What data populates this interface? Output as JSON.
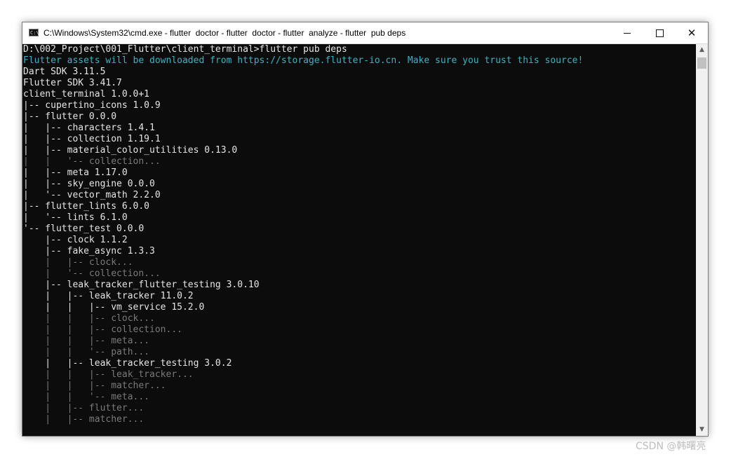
{
  "window": {
    "title": "C:\\Windows\\System32\\cmd.exe - flutter  doctor - flutter  doctor - flutter  analyze - flutter  pub deps",
    "icon_name": "cmd-icon",
    "minimize_label": "",
    "maximize_label": "",
    "close_label": "✕"
  },
  "colors": {
    "terminal_bg": "#0c0c0c",
    "text": "#cccccc",
    "cyan": "#3ab4c2",
    "dim": "#7a7a7a"
  },
  "terminal": {
    "lines": [
      {
        "text": "D:\\002_Project\\001_Flutter\\client_terminal>flutter pub deps",
        "style": "bright"
      },
      {
        "text": "Flutter assets will be downloaded from https://storage.flutter-io.cn. Make sure you trust this source!",
        "style": "cyan"
      },
      {
        "text": "Dart SDK 3.11.5",
        "style": "bright"
      },
      {
        "text": "Flutter SDK 3.41.7",
        "style": "bright"
      },
      {
        "text": "client_terminal 1.0.0+1",
        "style": "bright"
      },
      {
        "text": "|-- cupertino_icons 1.0.9",
        "style": "bright"
      },
      {
        "text": "|-- flutter 0.0.0",
        "style": "bright"
      },
      {
        "text": "|   |-- characters 1.4.1",
        "style": "bright"
      },
      {
        "text": "|   |-- collection 1.19.1",
        "style": "bright"
      },
      {
        "text": "|   |-- material_color_utilities 0.13.0",
        "style": "bright"
      },
      {
        "text": "|   |   '-- collection...",
        "style": "dim"
      },
      {
        "text": "|   |-- meta 1.17.0",
        "style": "bright"
      },
      {
        "text": "|   |-- sky_engine 0.0.0",
        "style": "bright"
      },
      {
        "text": "|   '-- vector_math 2.2.0",
        "style": "bright"
      },
      {
        "text": "|-- flutter_lints 6.0.0",
        "style": "bright"
      },
      {
        "text": "|   '-- lints 6.1.0",
        "style": "bright"
      },
      {
        "text": "'-- flutter_test 0.0.0",
        "style": "bright"
      },
      {
        "text": "    |-- clock 1.1.2",
        "style": "bright"
      },
      {
        "text": "    |-- fake_async 1.3.3",
        "style": "bright"
      },
      {
        "text": "    |   |-- clock...",
        "style": "dim"
      },
      {
        "text": "    |   '-- collection...",
        "style": "dim"
      },
      {
        "text": "    |-- leak_tracker_flutter_testing 3.0.10",
        "style": "bright"
      },
      {
        "text": "    |   |-- leak_tracker 11.0.2",
        "style": "bright"
      },
      {
        "text": "    |   |   |-- vm_service 15.2.0",
        "style": "bright"
      },
      {
        "text": "    |   |   |-- clock...",
        "style": "dim"
      },
      {
        "text": "    |   |   |-- collection...",
        "style": "dim"
      },
      {
        "text": "    |   |   |-- meta...",
        "style": "dim"
      },
      {
        "text": "    |   |   '-- path...",
        "style": "dim"
      },
      {
        "text": "    |   |-- leak_tracker_testing 3.0.2",
        "style": "bright"
      },
      {
        "text": "    |   |   |-- leak_tracker...",
        "style": "dim"
      },
      {
        "text": "    |   |   |-- matcher...",
        "style": "dim"
      },
      {
        "text": "    |   |   '-- meta...",
        "style": "dim"
      },
      {
        "text": "    |   |-- flutter...",
        "style": "dim"
      },
      {
        "text": "    |   |-- matcher...",
        "style": "dim"
      }
    ]
  },
  "scrollbar": {
    "up_icon": "▲",
    "down_icon": "▼"
  },
  "watermark": "CSDN @韩曙亮"
}
